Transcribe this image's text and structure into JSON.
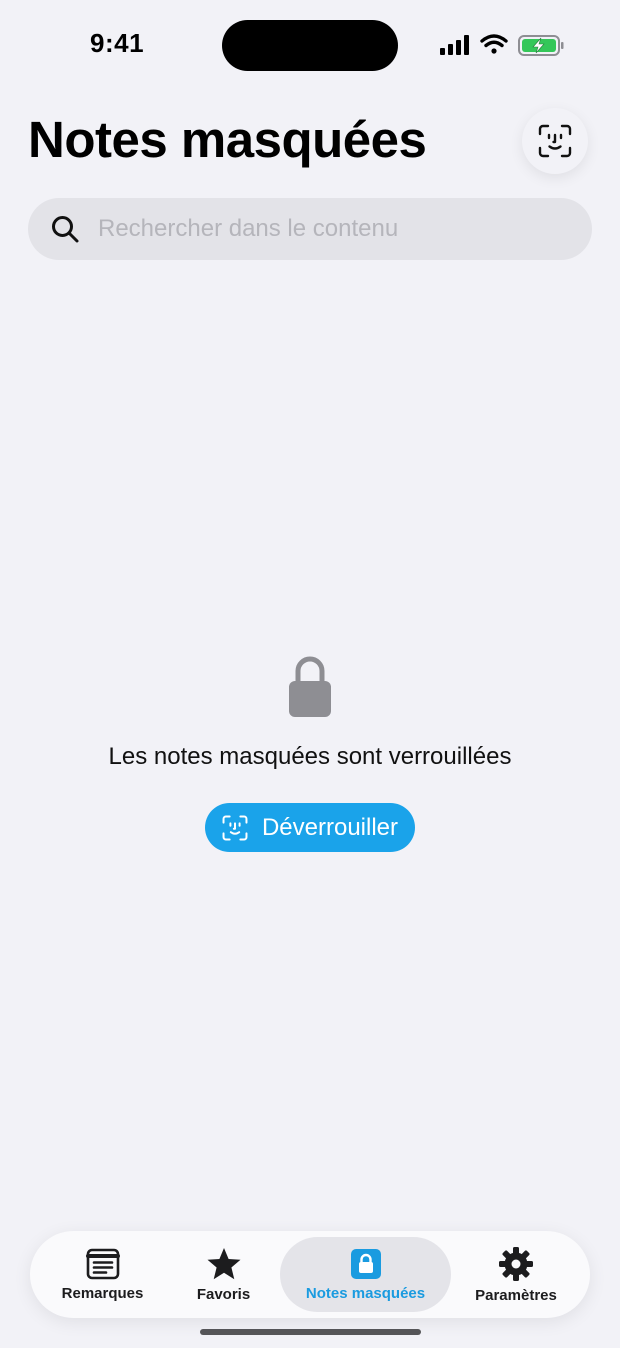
{
  "status_bar": {
    "time": "9:41"
  },
  "header": {
    "title": "Notes masquées",
    "faceid_icon": "faceid-icon"
  },
  "search": {
    "placeholder": "Rechercher dans le contenu",
    "value": "",
    "icon": "search-icon"
  },
  "empty_state": {
    "icon": "lock-icon",
    "message": "Les notes masquées sont verrouillées",
    "unlock_button": {
      "label": "Déverrouiller",
      "icon": "faceid-icon"
    }
  },
  "tabbar": {
    "tabs": [
      {
        "label": "Remarques",
        "icon": "note-icon",
        "active": false
      },
      {
        "label": "Favoris",
        "icon": "star-icon",
        "active": false
      },
      {
        "label": "Notes masquées",
        "icon": "lock-icon",
        "active": true
      },
      {
        "label": "Paramètres",
        "icon": "gear-icon",
        "active": false
      }
    ]
  },
  "colors": {
    "accent": "#1aa3ea",
    "background": "#f2f2f7",
    "battery_green": "#34c759"
  }
}
